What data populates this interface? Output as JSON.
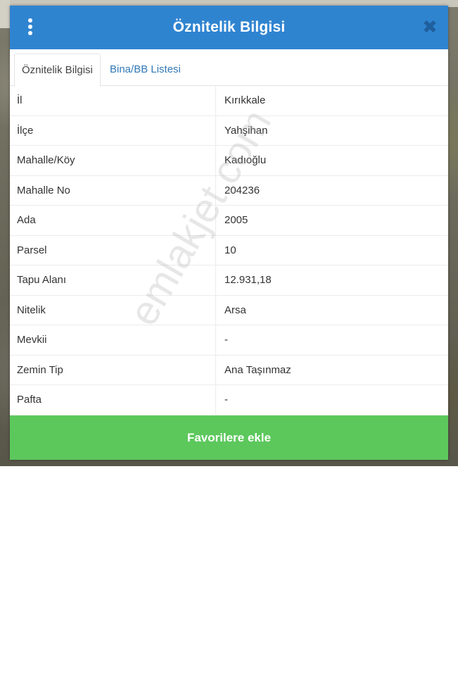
{
  "header": {
    "title": "Öznitelik Bilgisi",
    "menu_icon": "more-vertical-icon",
    "close_icon": "close-icon",
    "close_glyph": "✖",
    "color": "#2f84d0"
  },
  "tabs": [
    {
      "label": "Öznitelik Bilgisi",
      "active": true
    },
    {
      "label": "Bina/BB Listesi",
      "active": false
    }
  ],
  "attributes": [
    {
      "key": "İl",
      "value": "Kırıkkale"
    },
    {
      "key": "İlçe",
      "value": "Yahşihan"
    },
    {
      "key": "Mahalle/Köy",
      "value": "Kadıoğlu"
    },
    {
      "key": "Mahalle No",
      "value": "204236"
    },
    {
      "key": "Ada",
      "value": "2005"
    },
    {
      "key": "Parsel",
      "value": "10"
    },
    {
      "key": "Tapu Alanı",
      "value": "12.931,18"
    },
    {
      "key": "Nitelik",
      "value": "Arsa"
    },
    {
      "key": "Mevkii",
      "value": "-"
    },
    {
      "key": "Zemin Tip",
      "value": "Ana Taşınmaz"
    },
    {
      "key": "Pafta",
      "value": "-"
    }
  ],
  "favorite_button": {
    "label": "Favorilere ekle",
    "color": "#5cc85c"
  },
  "watermark": "emlakjet.com"
}
